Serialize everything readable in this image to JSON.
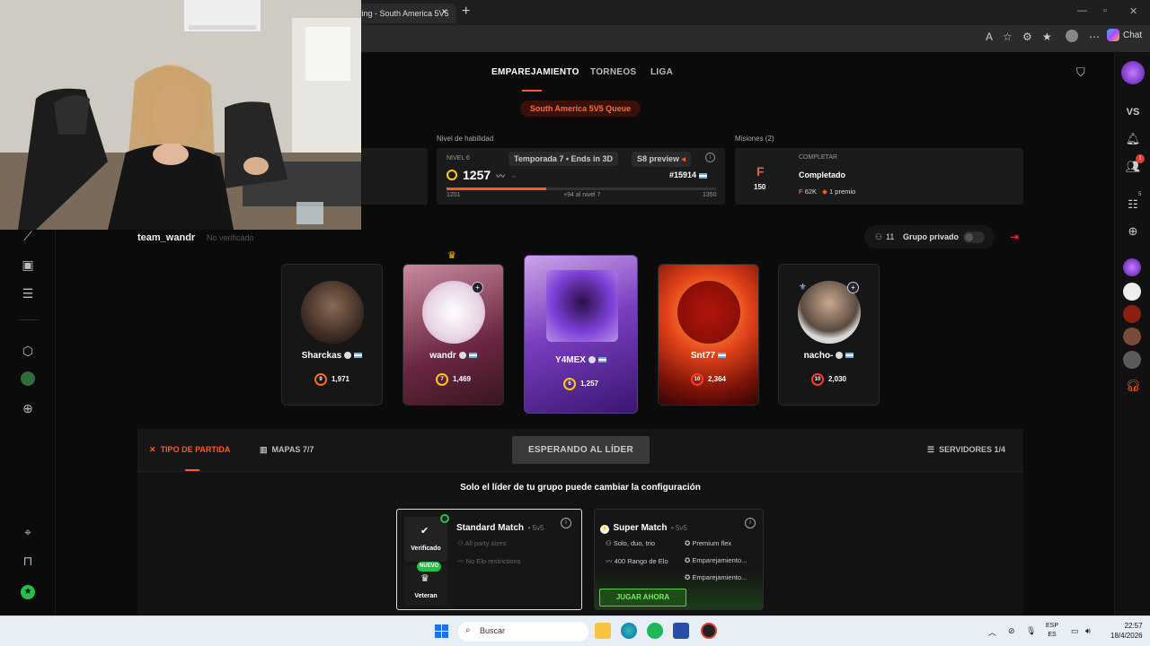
{
  "browser": {
    "tab_title": "ting - South America 5V5",
    "tab_close": "✕",
    "new_tab": "+",
    "chat_label": "Chat"
  },
  "nav": {
    "items": [
      "EMPAREJAMIENTO",
      "TORNEOS",
      "LIGA"
    ],
    "queue": "South America 5V5 Queue",
    "accent": "#ff5a1f"
  },
  "skill": {
    "section_label": "Nivel de habilidad",
    "level_label": "NIVEL 6",
    "elo": "1257",
    "season": "Temporada 7 • Ends in 3D",
    "preview": "S8 preview",
    "rank": "#15914",
    "range_min": "1201",
    "range_max": "1350",
    "to_next": "+94 al nivel 7",
    "progress": 0.37
  },
  "missions": {
    "section_label": "Misiones (2)",
    "status_label": "COMPLETAR",
    "title": "Completado",
    "points": "150",
    "reward_points": "62K",
    "reward_prize": "1 premio"
  },
  "party": {
    "team_name": "team_wandr",
    "not_verified": "No verificado",
    "group_count": "11",
    "group_label": "Grupo privado"
  },
  "players": [
    {
      "name": "Sharckas",
      "level": "9",
      "elo": "1,971"
    },
    {
      "name": "wandr",
      "level": "7",
      "elo": "1,469"
    },
    {
      "name": "Y4MEX",
      "level": "6",
      "elo": "1,257"
    },
    {
      "name": "Snt77",
      "level": "10",
      "elo": "2,364"
    },
    {
      "name": "nacho-",
      "level": "10",
      "elo": "2,030"
    }
  ],
  "config": {
    "tab_match_type": "TIPO DE PARTIDA",
    "tab_maps": "MAPAS 7/7",
    "wait_button": "ESPERANDO AL LÍDER",
    "tab_servers": "SERVIDORES 1/4",
    "leader_note": "Solo el líder de tu grupo puede cambiar la configuración"
  },
  "standard_match": {
    "title": "Standard Match",
    "mode": "• 5v5",
    "verified_label": "Verificado",
    "new_badge": "NUEVO",
    "veteran_label": "Veteran",
    "features": [
      "All party sizes",
      "No Elo restrictions"
    ]
  },
  "super_match": {
    "title": "Super Match",
    "mode": "• 5v5",
    "features": [
      "Solo, duo, trio",
      "Premium flex",
      "400 Rango de Elo",
      "Emparejamiento...",
      "Emparejamiento..."
    ],
    "play_button": "JUGAR AHORA"
  },
  "sidebar_right": {
    "vs_label": "VS",
    "notif_count": "1",
    "party_count": "5"
  },
  "taskbar": {
    "search_placeholder": "Buscar",
    "lang_top": "ESP",
    "lang_bottom": "ES",
    "time": "22:57",
    "date": "18/4/2026"
  }
}
